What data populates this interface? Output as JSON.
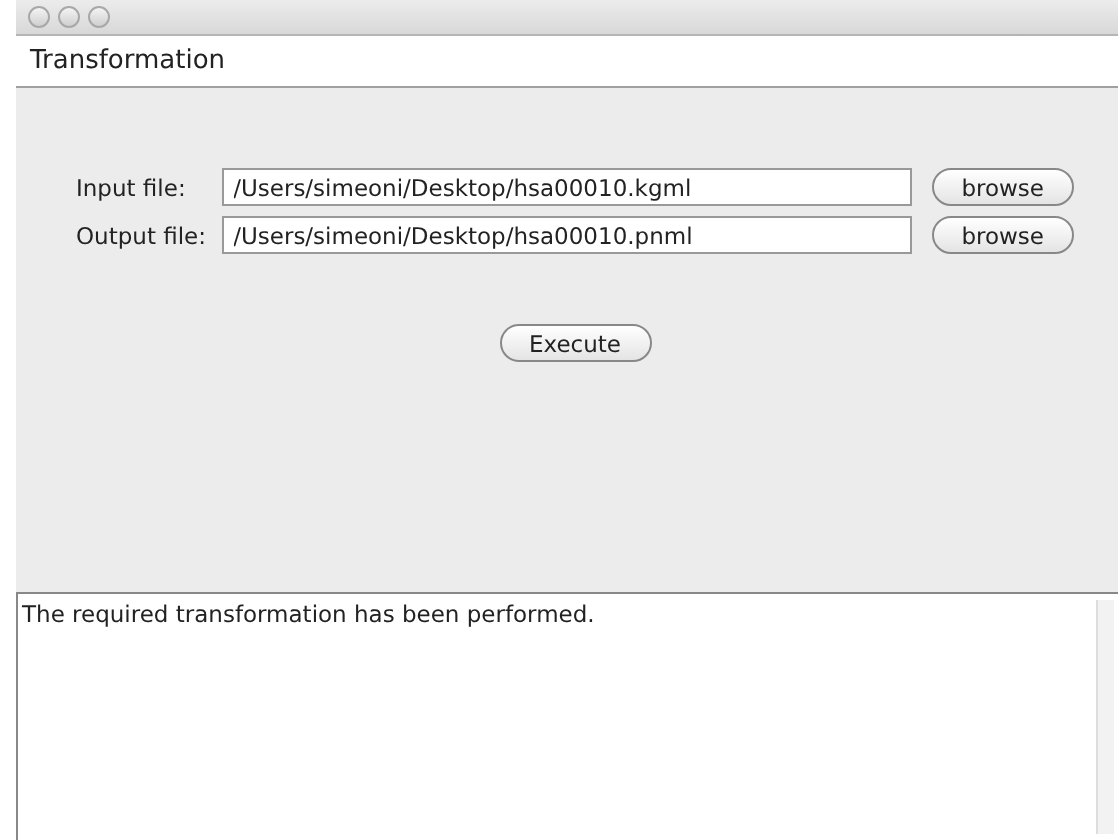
{
  "menu_bar": {
    "title": "Transformation"
  },
  "fields": [
    {
      "label": "Input file:",
      "value": "/Users/simeoni/Desktop/hsa00010.kgml",
      "button": "browse"
    },
    {
      "label": "Output file:",
      "value": "/Users/simeoni/Desktop/hsa00010.pnml",
      "button": "browse"
    }
  ],
  "execute_button": "Execute",
  "output": {
    "text": "The required transformation has been performed."
  }
}
